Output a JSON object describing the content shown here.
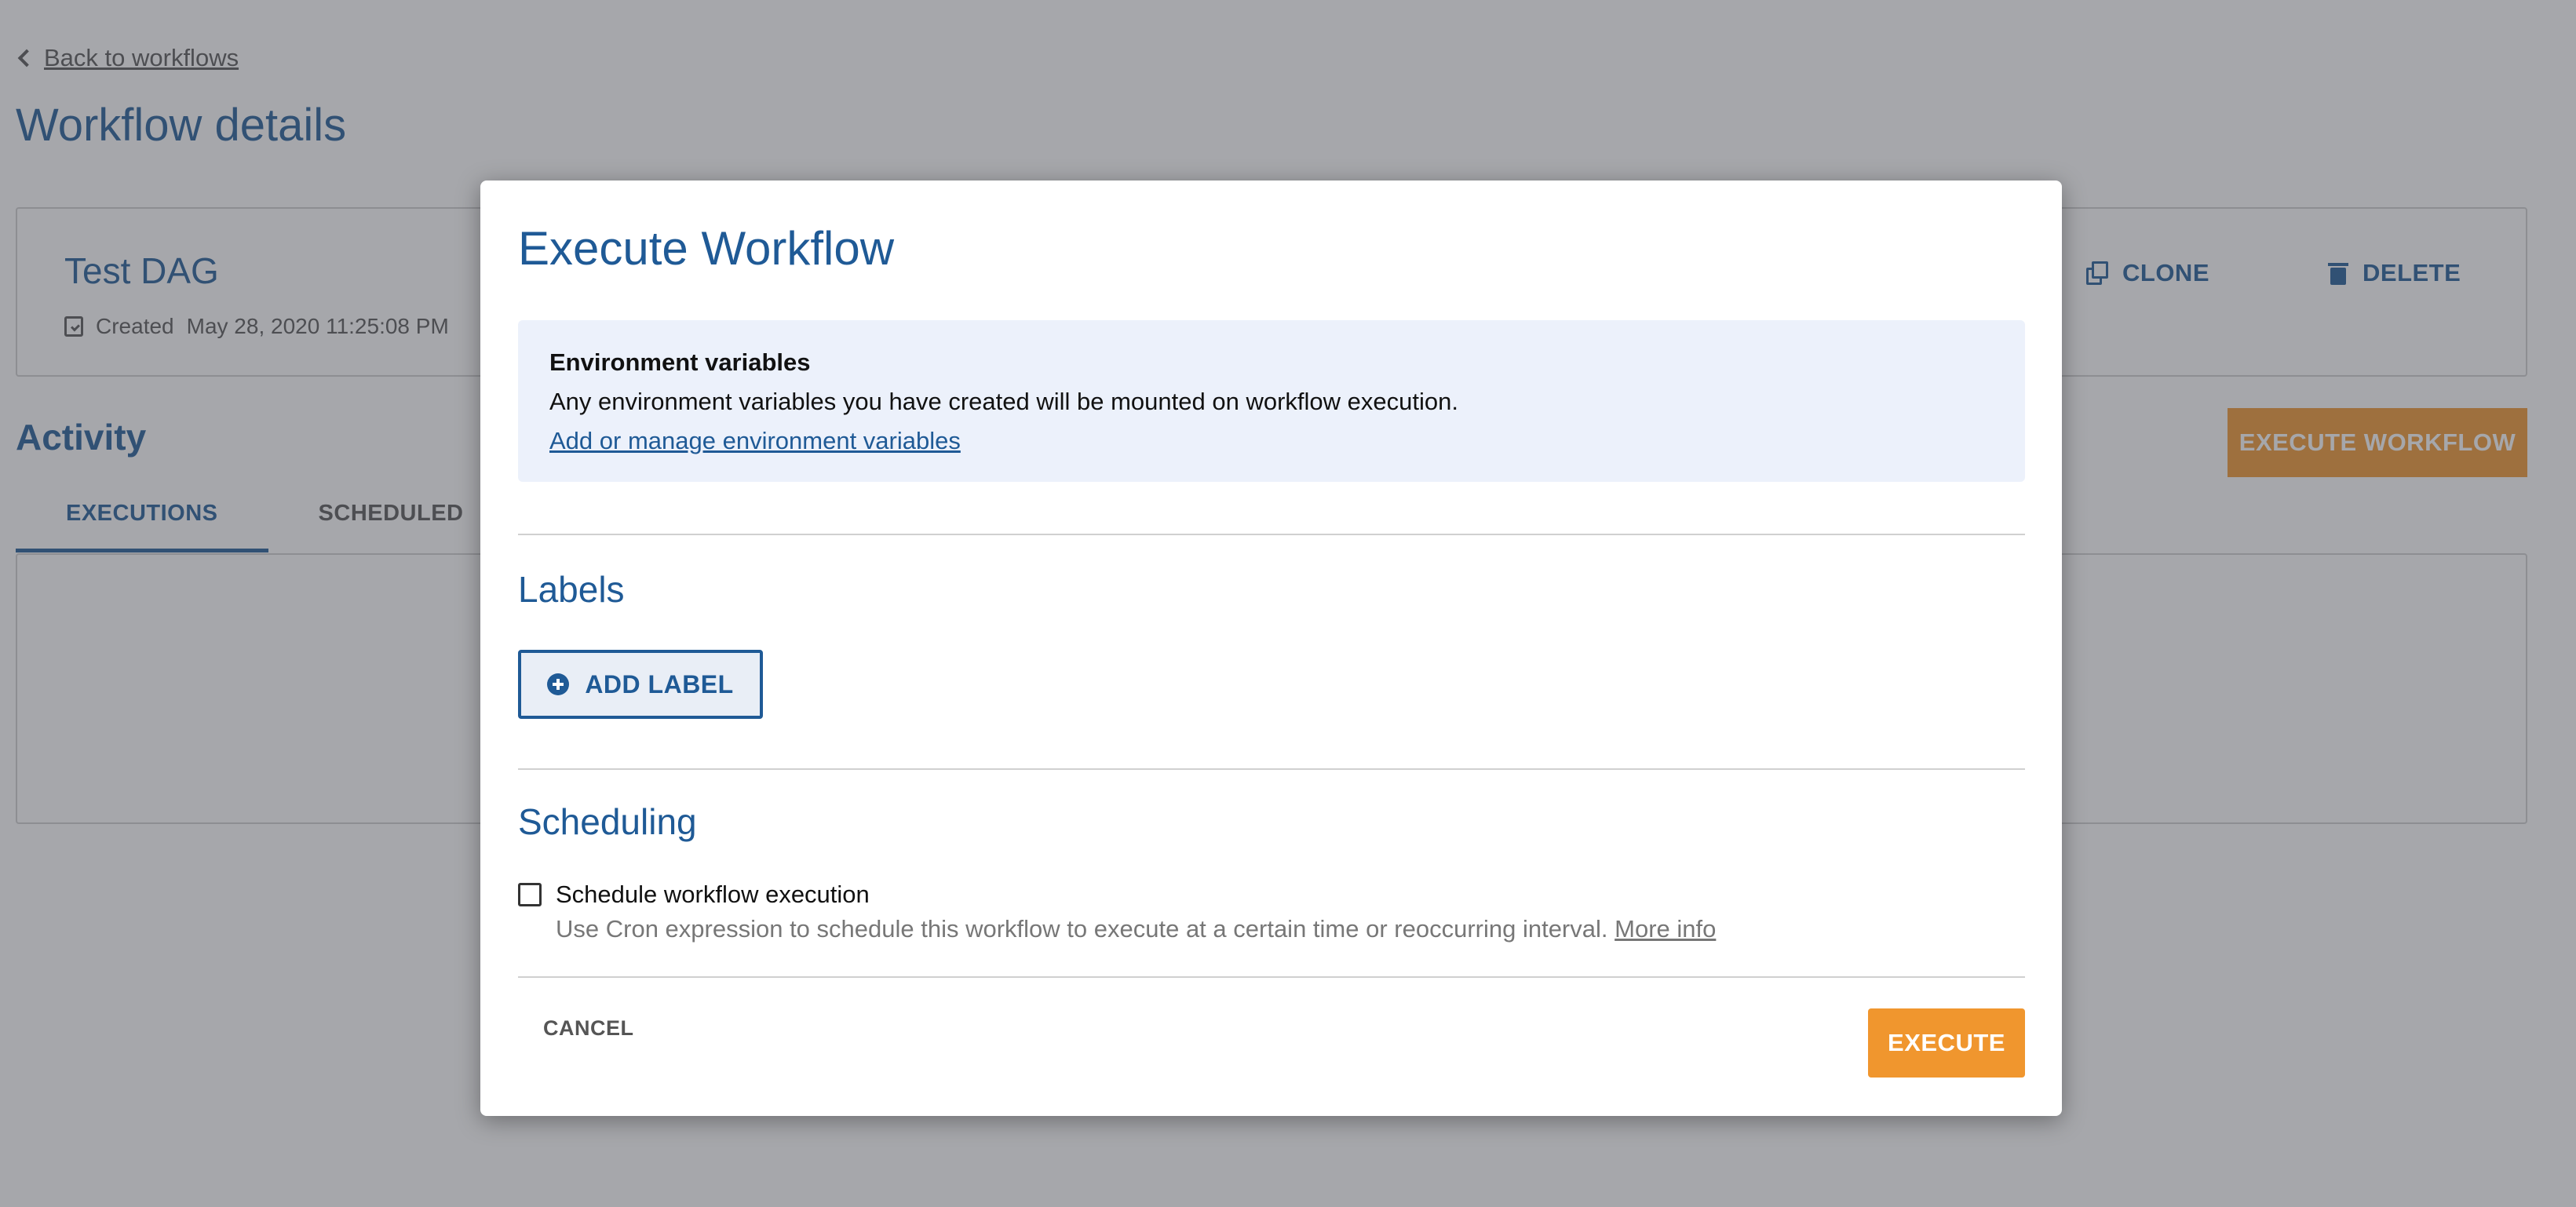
{
  "page": {
    "back_link": "Back to workflows",
    "title": "Workflow details",
    "workflow": {
      "name": "Test DAG",
      "created_label": "Created",
      "created_date": "May 28, 2020 11:25:08 PM"
    },
    "actions": {
      "clone": "CLONE",
      "delete": "DELETE"
    },
    "activity_title": "Activity",
    "execute_workflow_label": "EXECUTE WORKFLOW",
    "tabs": [
      {
        "label": "EXECUTIONS",
        "active": true
      },
      {
        "label": "SCHEDULED",
        "active": false
      }
    ]
  },
  "modal": {
    "title": "Execute Workflow",
    "env": {
      "title": "Environment variables",
      "description": "Any environment variables you have created will be mounted on workflow execution.",
      "link": "Add or manage environment variables"
    },
    "labels_section": {
      "title": "Labels",
      "add_label": "ADD LABEL"
    },
    "scheduling": {
      "title": "Scheduling",
      "checkbox_label": "Schedule workflow execution",
      "checked": false,
      "help_text": "Use Cron expression to schedule this workflow to execute at a certain time or reoccurring interval.",
      "more_info": "More info"
    },
    "cancel": "CANCEL",
    "execute": "EXECUTE"
  },
  "colors": {
    "primary": "#1f5a96",
    "accent": "#f0962e",
    "env_box_bg": "#ecf1fb"
  }
}
